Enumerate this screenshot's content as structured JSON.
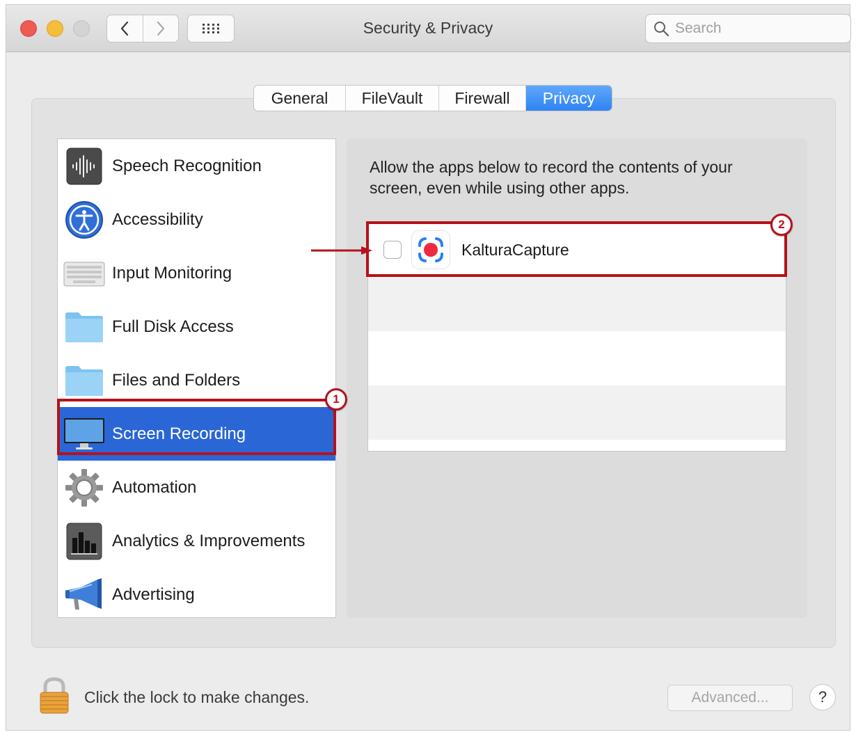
{
  "window": {
    "title": "Security & Privacy",
    "search_placeholder": "Search"
  },
  "tabs": [
    {
      "label": "General",
      "active": false
    },
    {
      "label": "FileVault",
      "active": false
    },
    {
      "label": "Firewall",
      "active": false
    },
    {
      "label": "Privacy",
      "active": true
    }
  ],
  "sidebar": {
    "items": [
      {
        "label": "Speech Recognition",
        "icon": "waveform-icon"
      },
      {
        "label": "Accessibility",
        "icon": "accessibility-icon"
      },
      {
        "label": "Input Monitoring",
        "icon": "keyboard-icon"
      },
      {
        "label": "Full Disk Access",
        "icon": "folder-icon"
      },
      {
        "label": "Files and Folders",
        "icon": "folder-icon"
      },
      {
        "label": "Screen Recording",
        "icon": "monitor-icon",
        "selected": true
      },
      {
        "label": "Automation",
        "icon": "gear-icon"
      },
      {
        "label": "Analytics & Improvements",
        "icon": "bar-chart-icon"
      },
      {
        "label": "Advertising",
        "icon": "megaphone-icon"
      }
    ]
  },
  "main": {
    "description": "Allow the apps below to record the contents of your screen, even while using other apps.",
    "apps": [
      {
        "name": "KalturaCapture",
        "checked": false,
        "icon": "record-capture-icon"
      }
    ]
  },
  "annotations": {
    "badge1": "1",
    "badge2": "2",
    "color": "#b4121c"
  },
  "footer": {
    "lock_text": "Click the lock to make changes.",
    "advanced_label": "Advanced...",
    "help_label": "?"
  },
  "colors": {
    "accent": "#2f84f3",
    "selection": "#2a66d6",
    "close": "#ee5b52",
    "minimize": "#f4bd3a"
  }
}
